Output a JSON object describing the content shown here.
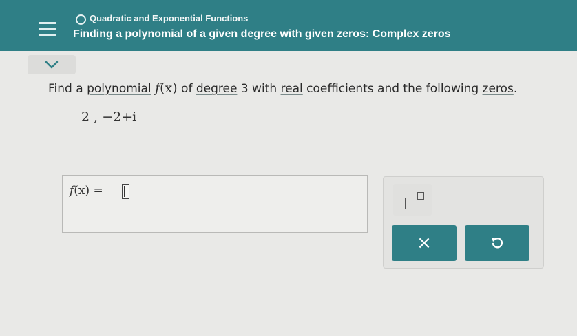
{
  "header": {
    "topic": "Quadratic and Exponential Functions",
    "subtitle": "Finding a polynomial of a given degree with given zeros: Complex zeros"
  },
  "icons": {
    "menu": "hamburger-menu-icon",
    "status": "circle-outline-icon",
    "collapse": "chevron-down-icon",
    "exponent": "exponent-template-icon",
    "clear": "x-icon",
    "undo": "undo-icon"
  },
  "question": {
    "part1": "Find a ",
    "link_polynomial": "polynomial",
    "fx": "f",
    "fx_paren": "(x)",
    "part2": " of ",
    "link_degree": "degree",
    "degree_value": " 3 ",
    "part3": "with ",
    "link_real": "real",
    "part4": " coefficients and the following ",
    "link_zeros": "zeros",
    "part5": "."
  },
  "zeros_text": "2 ,  −2+i",
  "answer": {
    "label_f": "f",
    "label_rest": "(x) =",
    "value": ""
  },
  "keypad": {
    "clear_label": "×"
  },
  "colors": {
    "header_bg": "#2f7f86",
    "page_bg": "#e9e9e7",
    "button_bg": "#2f7f86"
  }
}
